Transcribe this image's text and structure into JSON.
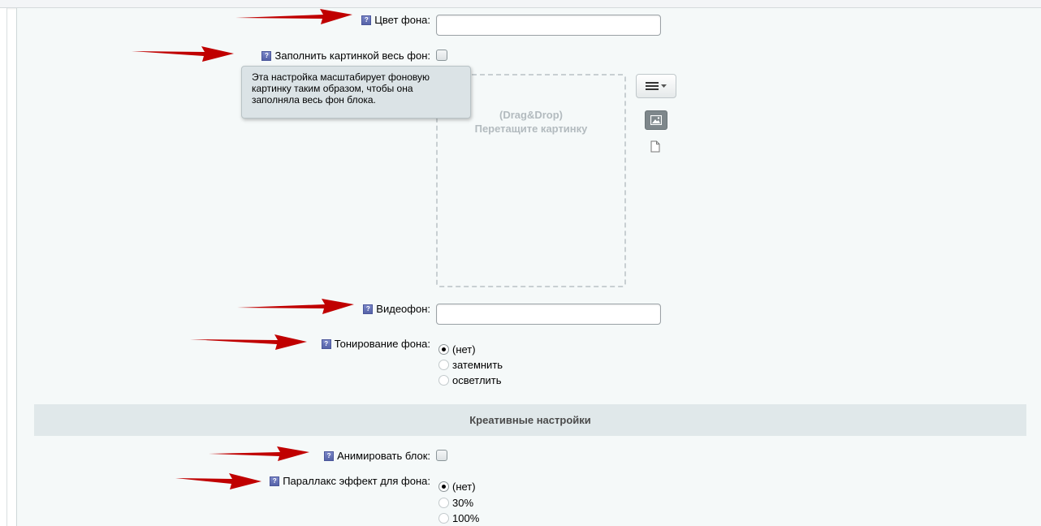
{
  "fields": {
    "bg_color": {
      "label": "Цвет фона:",
      "value": ""
    },
    "fill_image": {
      "label": "Заполнить картинкой весь фон:",
      "checked": false
    },
    "tooltip": {
      "text": "Эта настройка масштабирует фоновую картинку таким образом, чтобы она заполняла весь фон блока."
    },
    "dropzone": {
      "line1": "(Drag&Drop)",
      "line2": "Перетащите картинку"
    },
    "video_bg": {
      "label": "Видеофон:",
      "value": ""
    },
    "toning": {
      "label": "Тонирование фона:",
      "options": [
        {
          "label": "(нет)",
          "checked": true
        },
        {
          "label": "затемнить",
          "checked": false
        },
        {
          "label": "осветлить",
          "checked": false
        }
      ]
    }
  },
  "section": {
    "title": "Креативные настройки"
  },
  "creative": {
    "animate": {
      "label": "Анимировать блок:",
      "checked": false
    },
    "parallax": {
      "label": "Параллакс эффект для фона:",
      "options": [
        {
          "label": "(нет)",
          "checked": true
        },
        {
          "label": "30%",
          "checked": false
        },
        {
          "label": "100%",
          "checked": false
        }
      ]
    }
  },
  "hint_glyph": "?",
  "icons": {
    "menu": "menu-lines-icon",
    "image": "image-icon",
    "file": "file-icon",
    "arrow": "red-arrow-icon"
  },
  "colors": {
    "arrow": "#c00000",
    "panel": "#f5f9f9",
    "section": "#e0e8ea",
    "hint": "#5f6bb3"
  }
}
